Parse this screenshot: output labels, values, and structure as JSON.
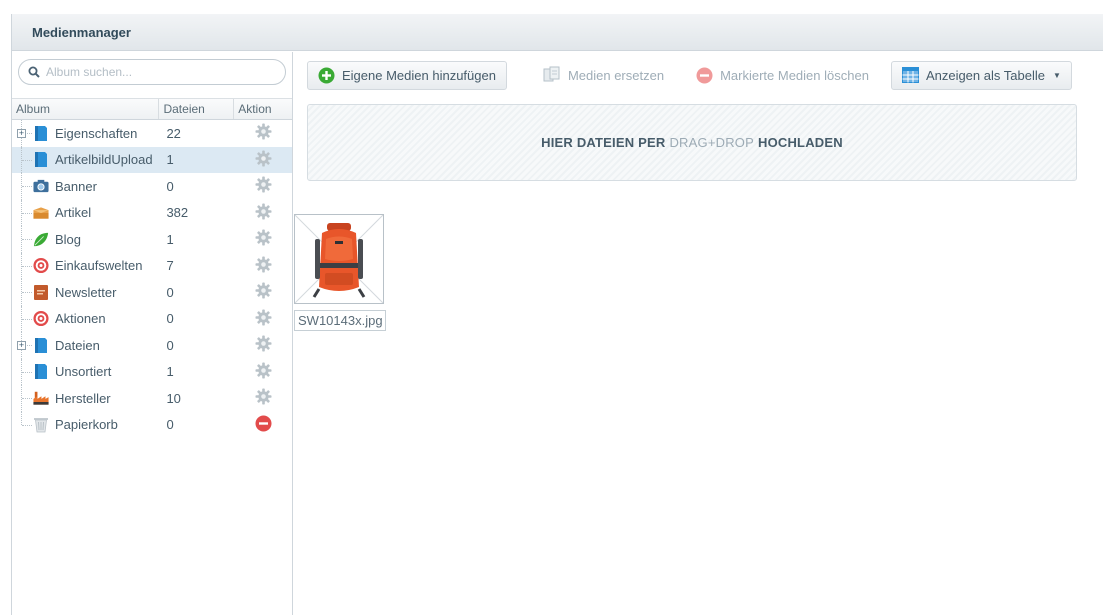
{
  "window": {
    "title": "Medienmanager"
  },
  "search": {
    "placeholder": "Album suchen..."
  },
  "grid": {
    "headers": {
      "album": "Album",
      "files": "Dateien",
      "action": "Aktion"
    },
    "albums": [
      {
        "label": "Eigenschaften",
        "count": "22",
        "icon": "folder-blue-icon",
        "expandable": true,
        "action": "settings"
      },
      {
        "label": "ArtikelbildUpload",
        "count": "1",
        "icon": "folder-blue-icon",
        "selected": true,
        "action": "settings"
      },
      {
        "label": "Banner",
        "count": "0",
        "icon": "camera-icon",
        "action": "settings"
      },
      {
        "label": "Artikel",
        "count": "382",
        "icon": "box-icon",
        "action": "settings"
      },
      {
        "label": "Blog",
        "count": "1",
        "icon": "leaf-icon",
        "action": "settings"
      },
      {
        "label": "Einkaufswelten",
        "count": "7",
        "icon": "target-icon",
        "action": "settings"
      },
      {
        "label": "Newsletter",
        "count": "0",
        "icon": "newsletter-icon",
        "action": "settings"
      },
      {
        "label": "Aktionen",
        "count": "0",
        "icon": "target-icon",
        "action": "settings"
      },
      {
        "label": "Dateien",
        "count": "0",
        "icon": "folder-blue-icon",
        "expandable": true,
        "action": "settings"
      },
      {
        "label": "Unsortiert",
        "count": "1",
        "icon": "folder-blue-icon",
        "action": "settings"
      },
      {
        "label": "Hersteller",
        "count": "10",
        "icon": "factory-icon",
        "action": "settings"
      },
      {
        "label": "Papierkorb",
        "count": "0",
        "icon": "trash-icon",
        "action": "delete"
      }
    ]
  },
  "toolbar": {
    "add_label": "Eigene Medien hinzufügen",
    "replace_label": "Medien ersetzen",
    "delete_label": "Markierte Medien löschen",
    "view_label": "Anzeigen als Tabelle"
  },
  "dropzone": {
    "part1": "HIER DATEIEN PER",
    "part2": "DRAG+DROP",
    "part3": "HOCHLADEN"
  },
  "media": [
    {
      "filename": "SW10143x.jpg",
      "icon": "backpack-image"
    }
  ],
  "colors": {
    "accent_blue": "#2a8fd6",
    "add_green": "#3aaa35",
    "delete_red": "#e24b4b",
    "selected_row": "#dce9f3"
  }
}
